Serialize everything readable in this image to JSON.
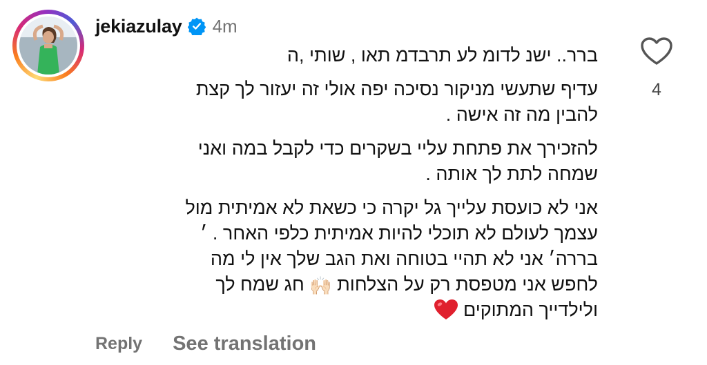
{
  "comment": {
    "username": "jekiazulay",
    "timestamp": "4m",
    "verified": true,
    "paragraphs": [
      [
        "ברר‭ה, יתוש , ואת מדברת על מודל נשי .."
      ],
      [
        "עדיף שתעשי מניקור נסיכה יפה אולי זה יעזור לך קצת",
        "להבין מה זה אישה ."
      ],
      [
        "להזכירך את פתחת עליי בשקרים כדי לקבל במה ואני",
        "שמחה לתת לך אותה ."
      ],
      [
        "אני לא כועסת עלייך גל יקרה כי כשאת לא אמיתית מול",
        "עצמך לעולם לא תוכלי להיות אמיתית כלפי האחר . ׳",
        "בררה׳ אני לא תהיי בטוחה ואת הגב שלך אין לי מה"
      ]
    ],
    "line_emoji_1": "לחפש אני מטפסת רק על הצלחות",
    "line_emoji_2": "חג שמח לך",
    "last_line": "ולילדייך המתוקים",
    "emoji_hands": "🙌🏻",
    "like_count": "4"
  },
  "icons": {
    "verified": "verified-badge-icon",
    "like": "heart-outline-icon",
    "heart": "red-heart-emoji"
  },
  "actions": {
    "reply": "Reply",
    "see_translation": "See translation"
  },
  "colors": {
    "verified_blue": "#0095f6",
    "muted_gray": "#737373",
    "heart_red": "#e0202e"
  }
}
